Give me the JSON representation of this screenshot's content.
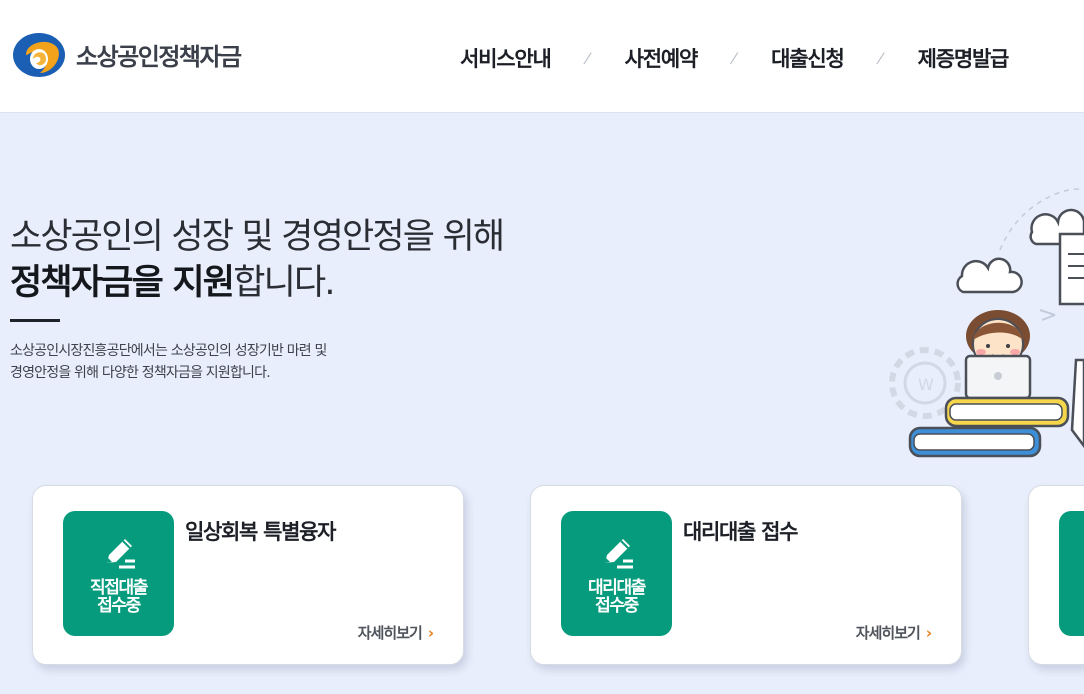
{
  "header": {
    "logo_text": "소상공인정책자금",
    "logo_icon": "swirl-logo-icon",
    "nav": [
      {
        "label": "서비스안내"
      },
      {
        "label": "사전예약"
      },
      {
        "label": "대출신청"
      },
      {
        "label": "제증명발급"
      }
    ],
    "separator": "⁄"
  },
  "hero": {
    "line1": "소상공인의 성장 및 경영안정을 위해",
    "line2_strong": "정책자금을 지원",
    "line2_rest": "합니다.",
    "desc_line1": "소상공인시장진흥공단에서는 소상공인의 성장기반 마련 및",
    "desc_line2": "경영안정을 위해 다양한 정책자금을 지원합니다."
  },
  "cards": [
    {
      "badge_line1": "직접대출",
      "badge_line2": "접수중",
      "title": "일상회복 특별융자",
      "more": "자세히보기",
      "icon": "pencil-icon"
    },
    {
      "badge_line1": "대리대출",
      "badge_line2": "접수중",
      "title": "대리대출 접수",
      "more": "자세히보기",
      "icon": "pencil-icon"
    }
  ],
  "colors": {
    "accent_green": "#079b7d",
    "more_arrow": "#e97f1a",
    "background": "#e8eefb",
    "logo_blue": "#1a5fb4",
    "logo_orange": "#f3a21b"
  }
}
